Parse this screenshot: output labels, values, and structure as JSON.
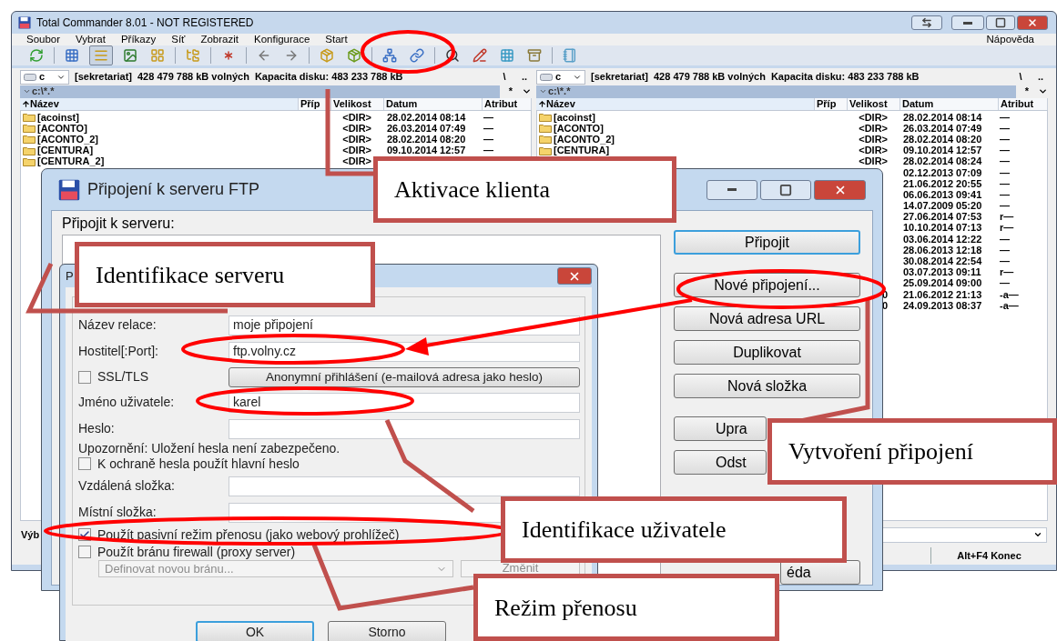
{
  "main_window": {
    "title": "Total Commander 8.01 - NOT REGISTERED",
    "menu": [
      "Soubor",
      "Vybrat",
      "Příkazy",
      "Síť",
      "Zobrazit",
      "Konfigurace",
      "Start"
    ],
    "help_menu": "Nápověda",
    "panels": [
      {
        "drive": "c",
        "volume": "[sekretariat]",
        "free": "428 479 788 kB volných",
        "capacity": "Kapacita disku: 483 233 788 kB",
        "root_button": "\\",
        "up_button": "..",
        "path": "c:\\*.*",
        "filter": "*",
        "columns": [
          "Název",
          "Příp",
          "Velikost",
          "Datum",
          "Atribut"
        ],
        "rows": [
          {
            "name": "[acoinst]",
            "size": "<DIR>",
            "date": "28.02.2014 08:14",
            "attr": "—"
          },
          {
            "name": "[ACONTO]",
            "size": "<DIR>",
            "date": "26.03.2014 07:49",
            "attr": "—"
          },
          {
            "name": "[ACONTO_2]",
            "size": "<DIR>",
            "date": "28.02.2014 08:20",
            "attr": "—"
          },
          {
            "name": "[CENTURA]",
            "size": "<DIR>",
            "date": "09.10.2014 12:57",
            "attr": "—"
          },
          {
            "name": "[CENTURA_2]",
            "size": "<DIR>"
          }
        ]
      },
      {
        "drive": "c",
        "volume": "[sekretariat]",
        "free": "428 479 788 kB volných",
        "capacity": "Kapacita disku: 483 233 788 kB",
        "root_button": "\\",
        "up_button": "..",
        "path": "c:\\*.*",
        "filter": "*",
        "columns": [
          "Název",
          "Příp",
          "Velikost",
          "Datum",
          "Atribut"
        ],
        "rows": [
          {
            "name": "[acoinst]",
            "size": "<DIR>",
            "date": "28.02.2014 08:14",
            "attr": "—"
          },
          {
            "name": "[ACONTO]",
            "size": "<DIR>",
            "date": "26.03.2014 07:49",
            "attr": "—"
          },
          {
            "name": "[ACONTO_2]",
            "size": "<DIR>",
            "date": "28.02.2014 08:20",
            "attr": "—"
          },
          {
            "name": "[CENTURA]",
            "size": "<DIR>",
            "date": "09.10.2014 12:57",
            "attr": "—"
          },
          {
            "size": "<DIR>",
            "date": "28.02.2014 08:24",
            "attr": "—"
          },
          {
            "date": "02.12.2013 07:09",
            "attr": "—"
          },
          {
            "date": "21.06.2012 20:55",
            "attr": "—"
          },
          {
            "date": "06.06.2013 09:41",
            "attr": "—"
          },
          {
            "date": "14.07.2009 05:20",
            "attr": "—"
          },
          {
            "date": "27.06.2014 07:53",
            "attr": "r—"
          },
          {
            "date": "10.10.2014 07:13",
            "attr": "r—"
          },
          {
            "date": "03.06.2014 12:22",
            "attr": "—"
          },
          {
            "date": "28.06.2013 12:18",
            "attr": "—"
          },
          {
            "date": "30.08.2014 22:54",
            "attr": "—"
          },
          {
            "date": "03.07.2013 09:11",
            "attr": "r—"
          },
          {
            "date": "25.09.2014 09:00",
            "attr": "—"
          },
          {
            "size": "0",
            "date": "21.06.2012 21:13",
            "attr": "-a—"
          },
          {
            "size": "0",
            "date": "24.09.2013 08:37",
            "attr": "-a—"
          }
        ]
      }
    ],
    "command_label": "Výb",
    "function_keys": [
      "Alt+F4 Konec"
    ]
  },
  "ftp_dialog": {
    "title": "Připojení k serveru FTP",
    "list_label": "Připojit k serveru:",
    "button_groups": [
      [
        {
          "kind": "normal",
          "label": "Připojit",
          "default": true
        }
      ],
      [
        {
          "kind": "normal",
          "label": "Nové připojení...",
          "default": false
        },
        {
          "kind": "normal",
          "label": "Nová adresa URL",
          "default": false
        },
        {
          "kind": "normal",
          "label": "Duplikovat",
          "default": false
        },
        {
          "kind": "normal",
          "label": "Nová složka",
          "default": false
        }
      ],
      [
        {
          "kind": "clipped",
          "label": "Upra",
          "default": false
        },
        {
          "kind": "clipped",
          "label": "Odst",
          "default": false
        },
        {
          "kind": "covered"
        },
        {
          "kind": "covered"
        }
      ],
      [
        {
          "kind": "clipped_end",
          "label": "éda",
          "default": false
        }
      ]
    ]
  },
  "session_dialog": {
    "title": "P",
    "rows": [
      {
        "kind": "field",
        "label": "Název relace:",
        "value": "moje připojení"
      },
      {
        "kind": "field",
        "label": "Hostitel[:Port]:",
        "value": "ftp.volny.cz"
      },
      {
        "kind": "checkbox_button",
        "label": "SSL/TLS",
        "checked": false,
        "button": "Anonymní přihlášení (e-mailová adresa jako heslo)"
      },
      {
        "kind": "field",
        "label": "Jméno uživatele:",
        "value": "karel"
      },
      {
        "kind": "field",
        "label": "Heslo:"
      },
      {
        "kind": "note",
        "text": "Upozornění: Uložení hesla není zabezpečeno."
      },
      {
        "kind": "checkbox",
        "label": "K ochraně hesla použít hlavní heslo",
        "checked": false
      },
      {
        "kind": "field",
        "label": "Vzdálená složka:"
      },
      {
        "kind": "field",
        "label": "Místní složka:"
      },
      {
        "kind": "checkbox",
        "label": "Použít pasivní režim přenosu (jako webový prohlížeč)",
        "checked": true
      },
      {
        "kind": "checkbox",
        "label": "Použít bránu firewall (proxy server)",
        "checked": false
      },
      {
        "kind": "dropdown",
        "value": "Definovat novou bránu...",
        "disabled": true,
        "button": "Změnit"
      }
    ],
    "buttons": [
      "OK",
      "Storno"
    ]
  },
  "callouts": [
    {
      "text": "Aktivace klienta"
    },
    {
      "text": "Identifikace serveru"
    },
    {
      "text": "Vytvoření připojení"
    },
    {
      "text": "Identifikace uživatele"
    },
    {
      "text": "Režim přenosu"
    }
  ]
}
